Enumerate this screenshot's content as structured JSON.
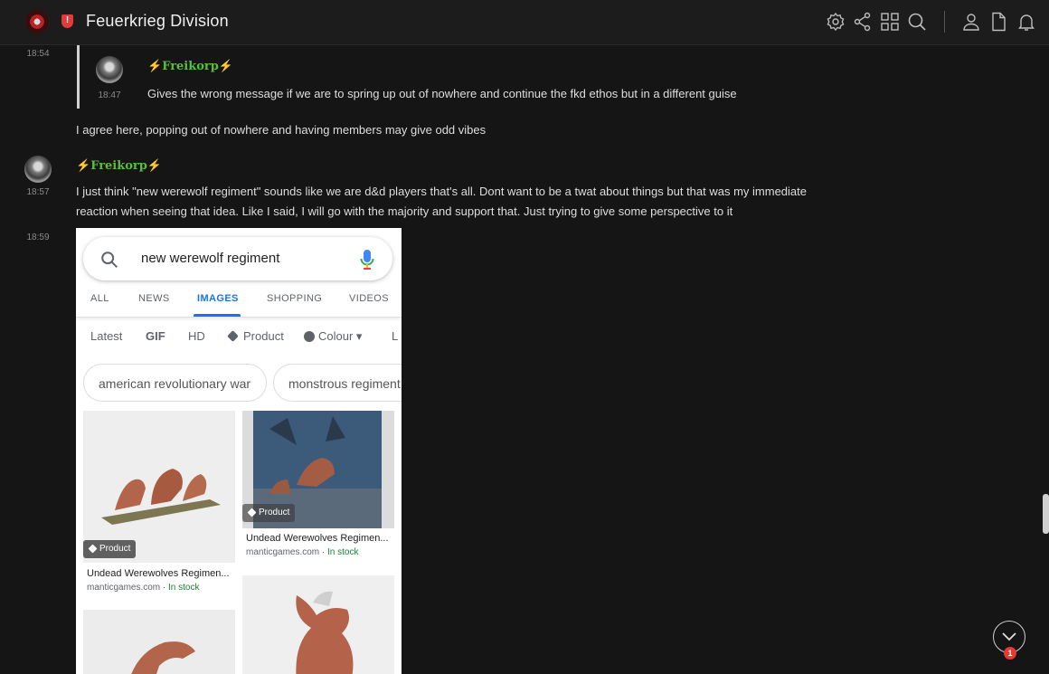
{
  "header": {
    "title": "Feuerkrieg Division",
    "icons": [
      "logo",
      "shield-alert-icon",
      "settings-icon",
      "share-icon",
      "grid-icon",
      "search-icon",
      "user-icon",
      "document-icon",
      "bell-icon"
    ]
  },
  "messages": [
    {
      "time": "18:54"
    },
    {
      "reply": {
        "time": "18:47",
        "username": "Freikorp",
        "text": "Gives the wrong message if we are to spring up out of nowhere and continue the fkd ethos but in a different guise"
      }
    },
    {
      "text": "I agree here, popping out of nowhere and having members may give odd vibes"
    },
    {
      "time": "18:57",
      "username": "Freikorp",
      "text_line1": "I just think \"new werewolf regiment\" sounds like we are d&d players that's all. Dont want to be a twat about things but that was my immediate",
      "text_line2": "reaction when seeing that idea. Like I said, I will go with the majority and support that. Just trying to give some perspective to it"
    },
    {
      "time": "18:59"
    }
  ],
  "bolt": "⚡",
  "screenshot": {
    "query": "new werewolf regiment",
    "tabs": [
      "ALL",
      "NEWS",
      "IMAGES",
      "SHOPPING",
      "VIDEOS"
    ],
    "active_tab": "IMAGES",
    "filters": [
      "Latest",
      "GIF",
      "HD",
      "Product",
      "Colour ▾",
      "L"
    ],
    "chips": [
      "american revolutionary war",
      "monstrous regiment"
    ],
    "results": [
      {
        "badge": "Product",
        "title": "Undead Werewolves Regimen...",
        "site": "manticgames.com",
        "stock": "In stock"
      },
      {
        "badge": "Product",
        "title": "Undead Werewolves Regimen...",
        "site": "manticgames.com",
        "stock": "In stock"
      }
    ],
    "site_sep": " · "
  },
  "unread_count": "1",
  "colors": {
    "username": "#5cbd3a",
    "bolt": "#f2c230",
    "google_blue": "#1a73e8",
    "in_stock": "#188038"
  }
}
